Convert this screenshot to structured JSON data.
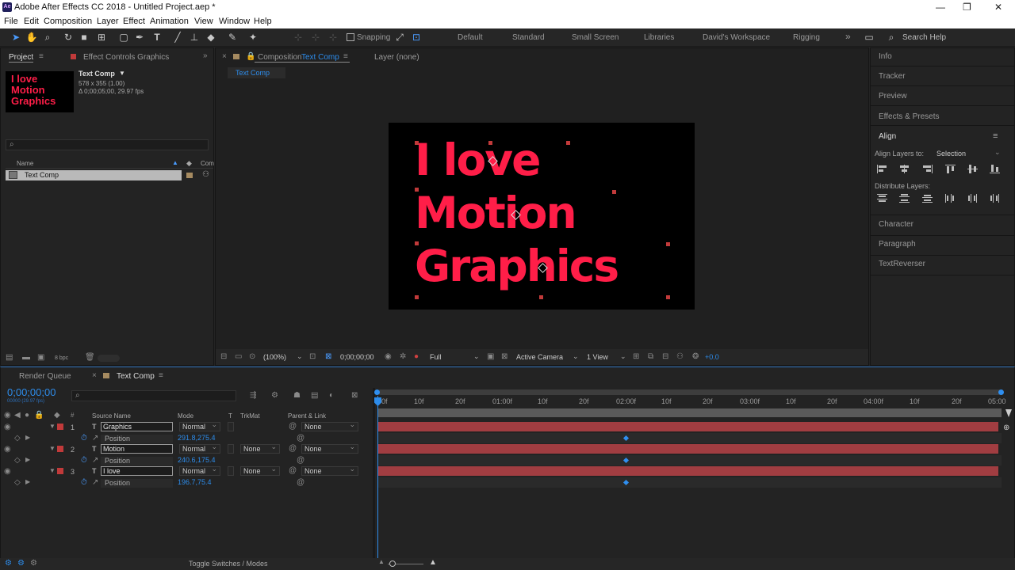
{
  "window": {
    "title": "Adobe After Effects CC 2018 - Untitled Project.aep *",
    "controls": [
      "—",
      "❐",
      "✕"
    ]
  },
  "menu": [
    "File",
    "Edit",
    "Composition",
    "Layer",
    "Effect",
    "Animation",
    "View",
    "Window",
    "Help"
  ],
  "toolbar": {
    "snapping": "Snapping",
    "workspaces": [
      "Default",
      "Standard",
      "Small Screen",
      "Libraries",
      "David's Workspace",
      "Rigging"
    ],
    "more": "»",
    "search": "Search Help"
  },
  "project": {
    "tab": "Project",
    "effect_tab": "Effect Controls Graphics",
    "thumb_lines": [
      "I love",
      "Motion",
      "Graphics"
    ],
    "comp_name": "Text Comp",
    "comp_size": "578 x 355 (1.00)",
    "comp_duration": "Δ 0;00;05;00, 29.97 fps",
    "col_name": "Name",
    "col_com": "Com",
    "item": "Text Comp",
    "bpc": "8 bpc"
  },
  "comp": {
    "tab_prefix": "Composition",
    "tab_name": "Text Comp",
    "layer_tab": "Layer (none)",
    "breadcrumb": "Text Comp",
    "lines": [
      "I love",
      "Motion",
      "Graphics"
    ],
    "zoom": "(100%)",
    "timecode": "0;00;00;00",
    "resolution": "Full",
    "camera": "Active Camera",
    "views": "1 View",
    "exposure": "+0.0"
  },
  "right": {
    "panels": [
      "Info",
      "Tracker",
      "Preview",
      "Effects & Presets"
    ],
    "align": "Align",
    "align_to_label": "Align Layers to:",
    "align_to": "Selection",
    "distribute": "Distribute Layers:",
    "panels2": [
      "Character",
      "Paragraph",
      "TextReverser"
    ]
  },
  "timeline": {
    "render_tab": "Render Queue",
    "comp_tab": "Text Comp",
    "timecode": "0;00;00;00",
    "timecode_sub": "00000 (29.97 fps)",
    "cols": {
      "source": "Source Name",
      "mode": "Mode",
      "t": "T",
      "trkmat": "TrkMat",
      "parent": "Parent & Link"
    },
    "layers": [
      {
        "num": "1",
        "name": "Graphics",
        "mode": "Normal",
        "trkmat": "",
        "parent": "None",
        "prop": "Position",
        "value": "291.8,275.4"
      },
      {
        "num": "2",
        "name": "Motion",
        "mode": "Normal",
        "trkmat": "None",
        "parent": "None",
        "prop": "Position",
        "value": "240.6,175.4"
      },
      {
        "num": "3",
        "name": "I love",
        "mode": "Normal",
        "trkmat": "None",
        "parent": "None",
        "prop": "Position",
        "value": "196.7,75.4"
      }
    ],
    "ruler": [
      "0f",
      "10f",
      "20f",
      "01:00f",
      "10f",
      "20f",
      "02:00f",
      "10f",
      "20f",
      "03:00f",
      "10f",
      "20f",
      "04:00f",
      "10f",
      "20f",
      "05:00"
    ],
    "toggle": "Toggle Switches / Modes"
  }
}
